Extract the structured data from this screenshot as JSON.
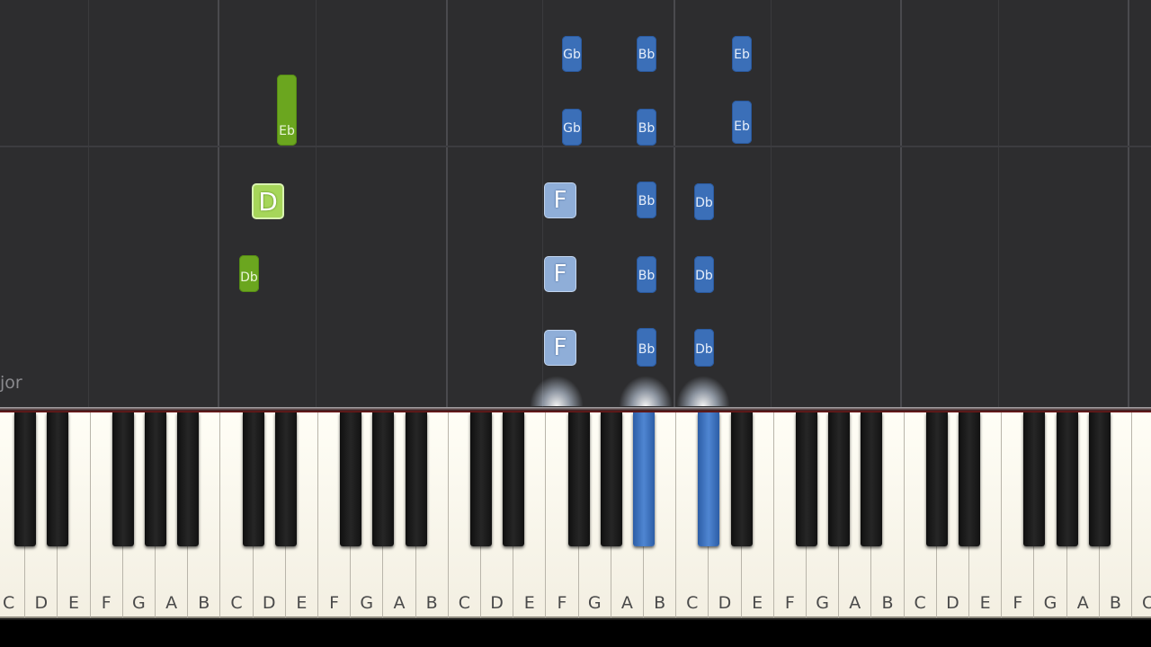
{
  "scale_label": "jor",
  "white_keys": [
    "C",
    "D",
    "E",
    "F",
    "G",
    "A",
    "B",
    "C",
    "D",
    "E",
    "F",
    "G",
    "A",
    "B",
    "C",
    "D",
    "E",
    "F",
    "G",
    "A",
    "B",
    "C",
    "D",
    "E",
    "F",
    "G",
    "A",
    "B",
    "C",
    "D",
    "E",
    "F",
    "G",
    "A",
    "B",
    "C"
  ],
  "pressed_keys": [
    "Bb",
    "Db"
  ],
  "notes": {
    "gb_top": "Gb",
    "bb_top": "Bb",
    "eb_top": "Eb",
    "gb_2": "Gb",
    "bb_2": "Bb",
    "eb_2": "Eb",
    "eb_green": "Eb",
    "d_green": "D",
    "db_green": "Db",
    "f_1": "F",
    "f_2": "F",
    "f_3": "F",
    "bb_3": "Bb",
    "bb_4": "Bb",
    "bb_5": "Bb",
    "db_1": "Db",
    "db_2": "Db",
    "db_3": "Db"
  },
  "colors": {
    "right_hand": "#3b6fb8",
    "left_hand": "#6ba61f",
    "highlight_green": "#a6d65a",
    "highlight_blue": "#8faed8"
  }
}
